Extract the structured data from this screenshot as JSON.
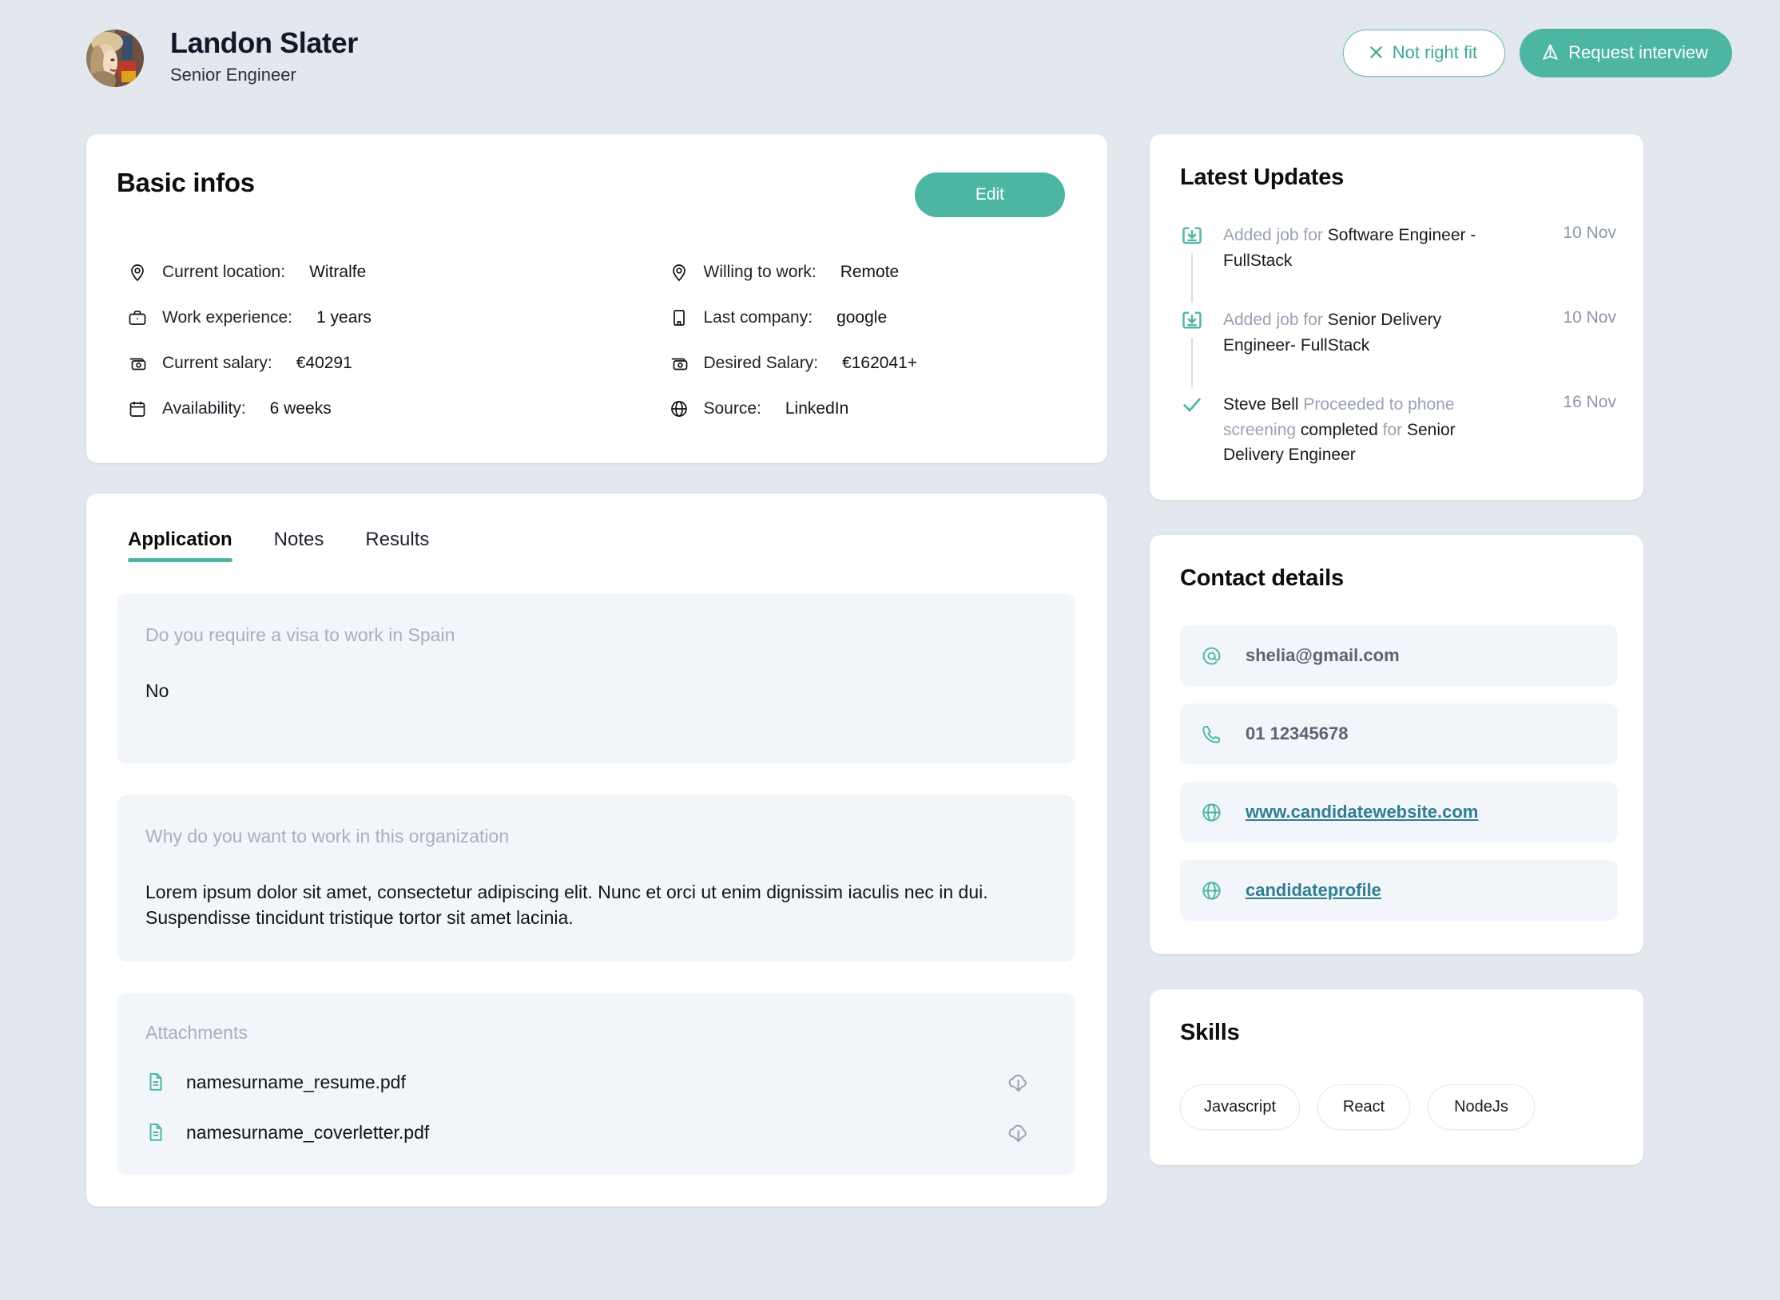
{
  "header": {
    "name": "Landon Slater",
    "role": "Senior Engineer",
    "avatar_name": "candidate-avatar",
    "actions": {
      "reject_label": "Not right fit",
      "reject_icon": "close-x-icon",
      "interview_label": "Request interview",
      "interview_icon": "megaphone-icon"
    }
  },
  "basic_infos": {
    "title": "Basic infos",
    "edit_label": "Edit",
    "left_rows": [
      {
        "icon": "location-pin-icon",
        "label": "Current location:",
        "value": "Witralfe"
      },
      {
        "icon": "briefcase-icon",
        "label": "Work experience:",
        "value": "1 years"
      },
      {
        "icon": "money-icon",
        "label": "Current salary:",
        "value": "€40291"
      },
      {
        "icon": "calendar-icon",
        "label": "Availability:",
        "value": "6 weeks"
      }
    ],
    "right_rows": [
      {
        "icon": "location-pin-icon",
        "label": "Willing to work:",
        "value": "Remote"
      },
      {
        "icon": "building-icon",
        "label": "Last company:",
        "value": "google"
      },
      {
        "icon": "money-icon",
        "label": "Desired Salary:",
        "value": "€162041+"
      },
      {
        "icon": "globe-icon",
        "label": "Source:",
        "value": "LinkedIn"
      }
    ]
  },
  "application_panel": {
    "tabs": [
      {
        "label": "Application",
        "active": true
      },
      {
        "label": "Notes",
        "active": false
      },
      {
        "label": "Results",
        "active": false
      }
    ],
    "questions": [
      {
        "question": "Do you require a visa to work in Spain",
        "answer": "No"
      },
      {
        "question": "Why do you want to work in this organization",
        "answer": "Lorem ipsum dolor sit amet, consectetur adipiscing elit. Nunc et orci ut enim dignissim iaculis nec in dui. Suspendisse tincidunt tristique tortor sit amet lacinia."
      }
    ],
    "attachments_title": "Attachments",
    "attachments": [
      {
        "name": "namesurname_resume.pdf",
        "file_icon": "file-document-icon",
        "download_icon": "cloud-download-icon"
      },
      {
        "name": "namesurname_coverletter.pdf",
        "file_icon": "file-document-icon",
        "download_icon": "cloud-download-icon"
      }
    ]
  },
  "latest_updates": {
    "title": "Latest Updates",
    "items": [
      {
        "icon": "archive-download-icon",
        "prefix": "Added job for ",
        "strong": "Software Engineer - FullStack",
        "suffix": "",
        "date": "10 Nov"
      },
      {
        "icon": "archive-download-icon",
        "prefix": "Added job for ",
        "strong": "Senior Delivery Engineer- FullStack",
        "suffix": "",
        "date": "10 Nov"
      },
      {
        "icon": "check-icon",
        "prefix": "",
        "strong": "Steve Bell",
        "mid": " Proceeded to phone screening ",
        "strong2": "completed",
        "mid2": " for ",
        "strong3": "Senior Delivery Engineer",
        "date": "16 Nov"
      }
    ]
  },
  "contact_details": {
    "title": "Contact details",
    "rows": [
      {
        "icon": "at-email-icon",
        "text": "shelia@gmail.com",
        "is_link": false
      },
      {
        "icon": "phone-icon",
        "text": "01 12345678",
        "is_link": false
      },
      {
        "icon": "globe-icon",
        "text": "www.candidatewebsite.com",
        "is_link": true
      },
      {
        "icon": "globe-icon",
        "text": "candidateprofile",
        "is_link": true
      }
    ]
  },
  "skills": {
    "title": "Skills",
    "items": [
      "Javascript",
      "React",
      "NodeJs"
    ]
  },
  "colors": {
    "page_bg": "#e3e7ee",
    "accent": "#4db6a3",
    "card_bg": "#ffffff",
    "subtle_bg": "#f2f5f9",
    "muted_text": "#a8afbd",
    "link": "#2f7f92"
  }
}
